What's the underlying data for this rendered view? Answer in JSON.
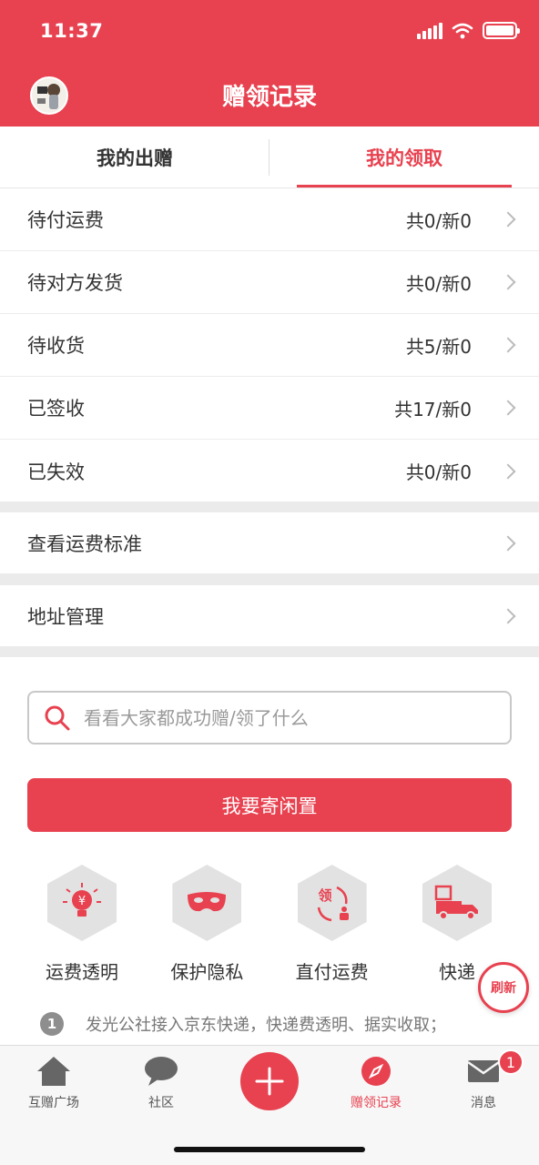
{
  "status_bar": {
    "time": "11:37"
  },
  "header": {
    "title": "赠领记录"
  },
  "tabs": [
    {
      "label": "我的出赠",
      "active": false
    },
    {
      "label": "我的领取",
      "active": true
    }
  ],
  "status_list": [
    {
      "label": "待付运费",
      "count": "共0/新0"
    },
    {
      "label": "待对方发货",
      "count": "共0/新0"
    },
    {
      "label": "待收货",
      "count": "共5/新0"
    },
    {
      "label": "已签收",
      "count": "共17/新0"
    },
    {
      "label": "已失效",
      "count": "共0/新0"
    }
  ],
  "links": {
    "shipping_standard": "查看运费标准",
    "address_management": "地址管理"
  },
  "search": {
    "placeholder": "看看大家都成功赠/领了什么"
  },
  "cta": {
    "label": "我要寄闲置"
  },
  "features": [
    {
      "label": "运费透明",
      "icon": "yen-bulb-icon"
    },
    {
      "label": "保护隐私",
      "icon": "mask-icon"
    },
    {
      "label": "直付运费",
      "icon": "direct-pay-icon"
    },
    {
      "label": "快递",
      "icon": "delivery-truck-icon"
    }
  ],
  "note": {
    "number": "1",
    "text": "发光公社接入京东快递，快递费透明、据实收取；"
  },
  "refresh": {
    "label": "刷新"
  },
  "bottom_nav": [
    {
      "label": "互赠广场",
      "icon": "home-icon"
    },
    {
      "label": "社区",
      "icon": "chat-bubble-icon"
    },
    {
      "label": "",
      "icon": "plus-icon"
    },
    {
      "label": "赠领记录",
      "icon": "compass-icon",
      "active": true
    },
    {
      "label": "消息",
      "icon": "mail-icon"
    }
  ],
  "message_badge": "1",
  "colors": {
    "brand": "#e8414f",
    "gap": "#ebebeb"
  }
}
